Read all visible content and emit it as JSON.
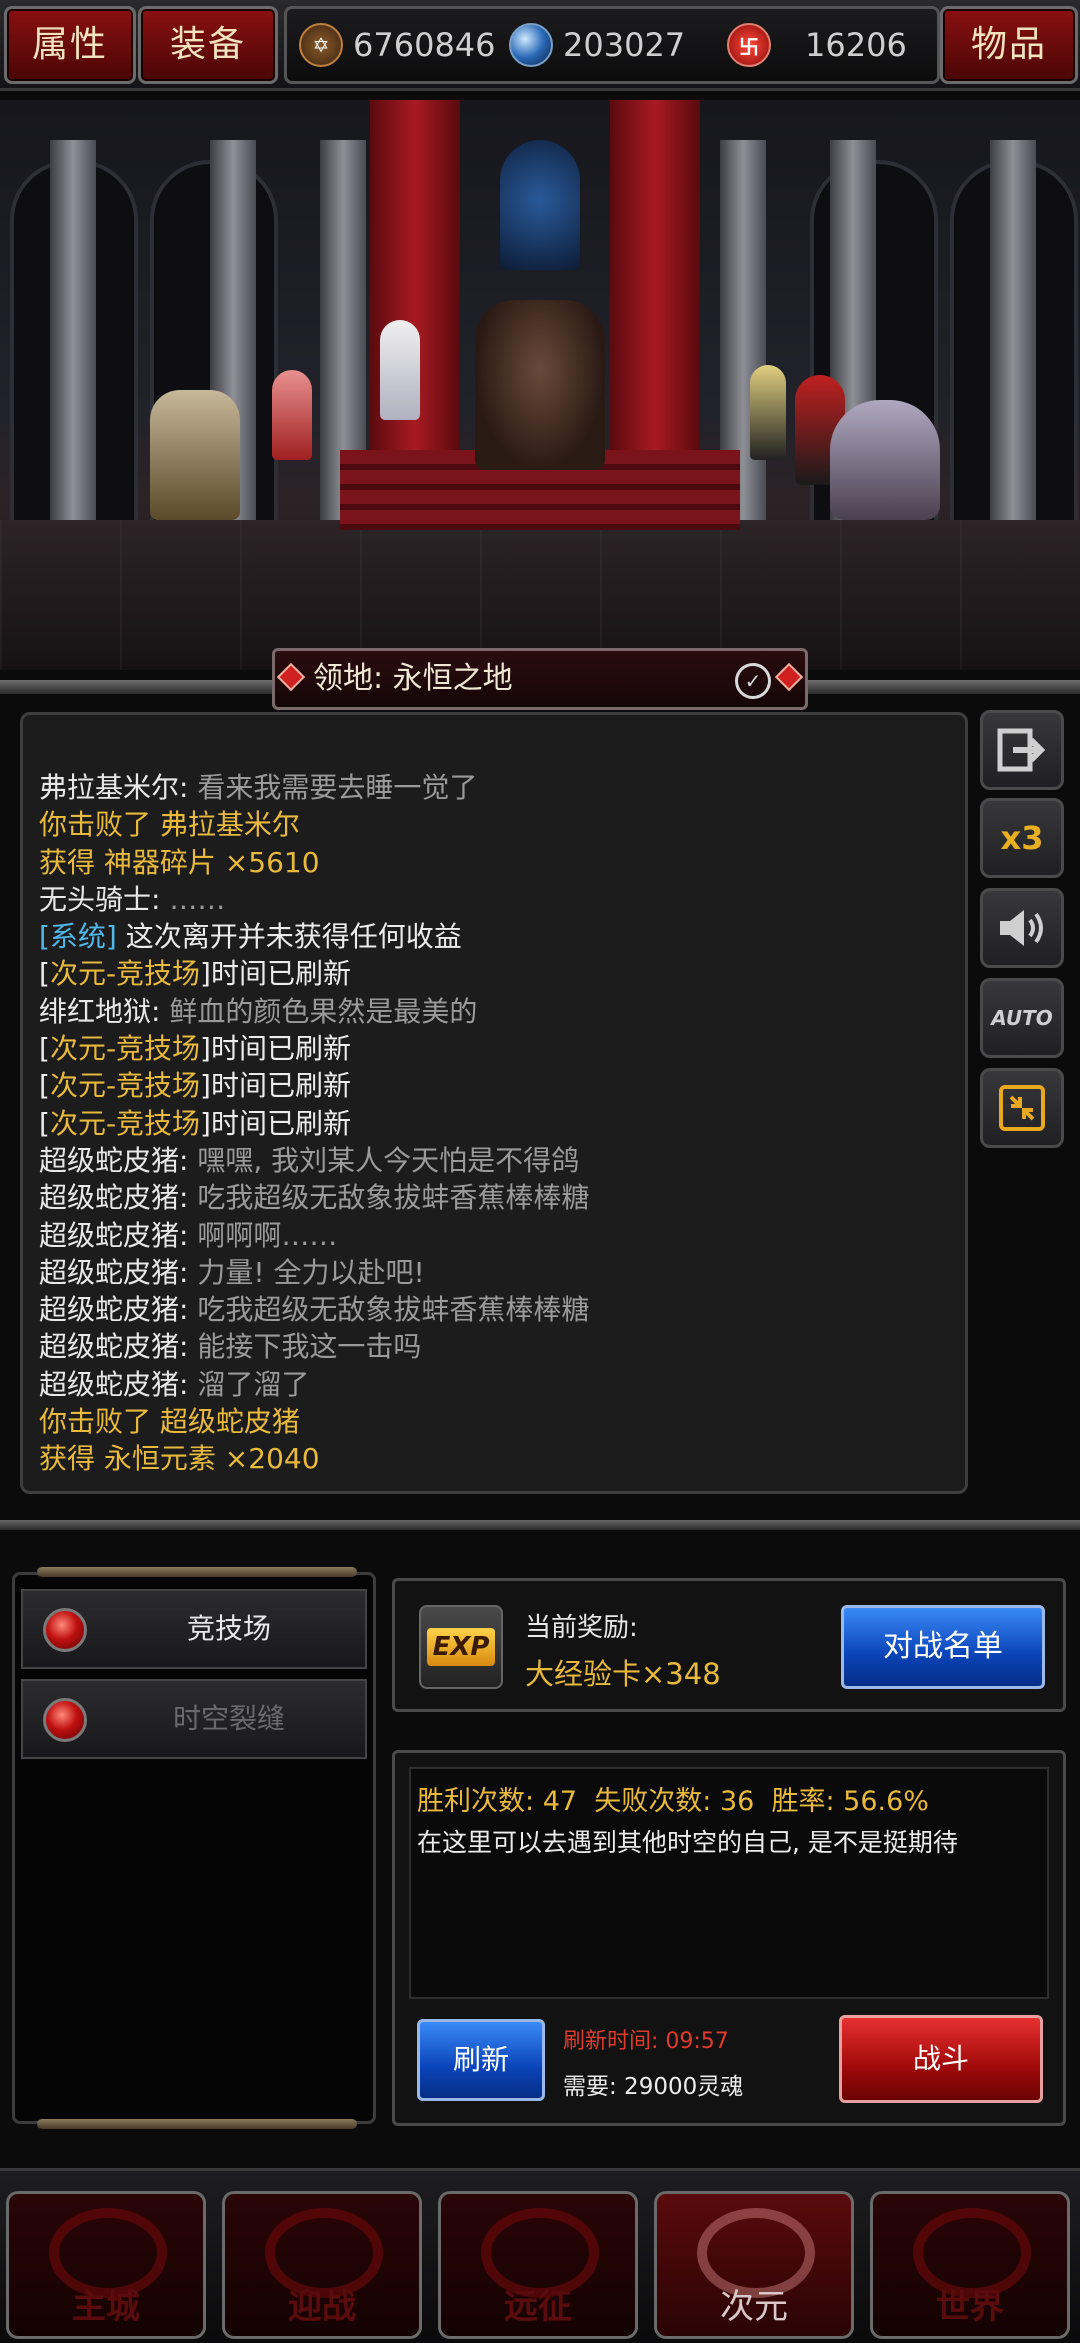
{
  "topbar": {
    "attributes_label": "属性",
    "equipment_label": "装备",
    "items_label": "物品",
    "resources": [
      {
        "icon": "pentagram-coin-icon",
        "value": "6760846"
      },
      {
        "icon": "blue-orb-icon",
        "value": "203027"
      },
      {
        "icon": "red-rune-icon",
        "value": "16206"
      }
    ]
  },
  "scene": {
    "territory_label": "领地: 永恒之地"
  },
  "chat": {
    "lines": [
      {
        "a": "弗拉基米尔: ",
        "b": "看来我需要去睡一觉了"
      },
      {
        "a": "你击败了 弗拉基米尔",
        "b": ""
      },
      {
        "a": "获得 神器碎片 ×5610",
        "b": ""
      },
      {
        "a": "无头骑士: ",
        "b": "……"
      },
      {
        "a": "[系统]",
        "b": " 这次离开并未获得任何收益"
      },
      {
        "a": "次元-竞技场",
        "b": "时间已刷新"
      },
      {
        "a": "绯红地狱: ",
        "b": "鲜血的颜色果然是最美的"
      },
      {
        "a": "次元-竞技场",
        "b": "时间已刷新"
      },
      {
        "a": "次元-竞技场",
        "b": "时间已刷新"
      },
      {
        "a": "次元-竞技场",
        "b": "时间已刷新"
      },
      {
        "a": "超级蛇皮猪: ",
        "b": "嘿嘿, 我刘某人今天怕是不得鸽"
      },
      {
        "a": "超级蛇皮猪: ",
        "b": "吃我超级无敌象拔蚌香蕉棒棒糖"
      },
      {
        "a": "超级蛇皮猪: ",
        "b": "啊啊啊……"
      },
      {
        "a": "超级蛇皮猪: ",
        "b": "力量! 全力以赴吧!"
      },
      {
        "a": "超级蛇皮猪: ",
        "b": "吃我超级无敌象拔蚌香蕉棒棒糖"
      },
      {
        "a": "超级蛇皮猪: ",
        "b": "能接下我这一击吗"
      },
      {
        "a": "超级蛇皮猪: ",
        "b": "溜了溜了"
      },
      {
        "a": "你击败了 超级蛇皮猪",
        "b": ""
      },
      {
        "a": "获得 永恒元素 ×2040",
        "b": ""
      }
    ]
  },
  "side_buttons": {
    "exit_icon": "exit-icon",
    "speed_label": "x3",
    "sound_icon": "speaker-icon",
    "auto_label": "AUTO",
    "shrink_icon": "shrink-icon"
  },
  "arena_menu": {
    "items": [
      {
        "label": "竞技场"
      },
      {
        "label": "时空裂缝"
      }
    ]
  },
  "reward": {
    "icon_text": "EXP",
    "title": "当前奖励:",
    "value": "大经验卡×348",
    "battle_list_label": "对战名单"
  },
  "stats": {
    "wins_label": "胜利次数:",
    "wins": "47",
    "losses_label": "失败次数:",
    "losses": "36",
    "rate_label": "胜率:",
    "rate": "56.6%",
    "description": "在这里可以去遇到其他时空的自己, 是不是挺期待",
    "refresh_label": "刷新",
    "refresh_time_label": "刷新时间: 09:57",
    "cost_label": "需要: 29000灵魂",
    "fight_label": "战斗"
  },
  "bottom_nav": {
    "items": [
      {
        "label": "主城"
      },
      {
        "label": "迎战"
      },
      {
        "label": "远征"
      },
      {
        "label": "次元"
      },
      {
        "label": "世界"
      }
    ]
  },
  "colors": {
    "gold_text": "#e8b93a",
    "system_blue": "#4fb8e8",
    "red_time": "#e03a2a"
  }
}
